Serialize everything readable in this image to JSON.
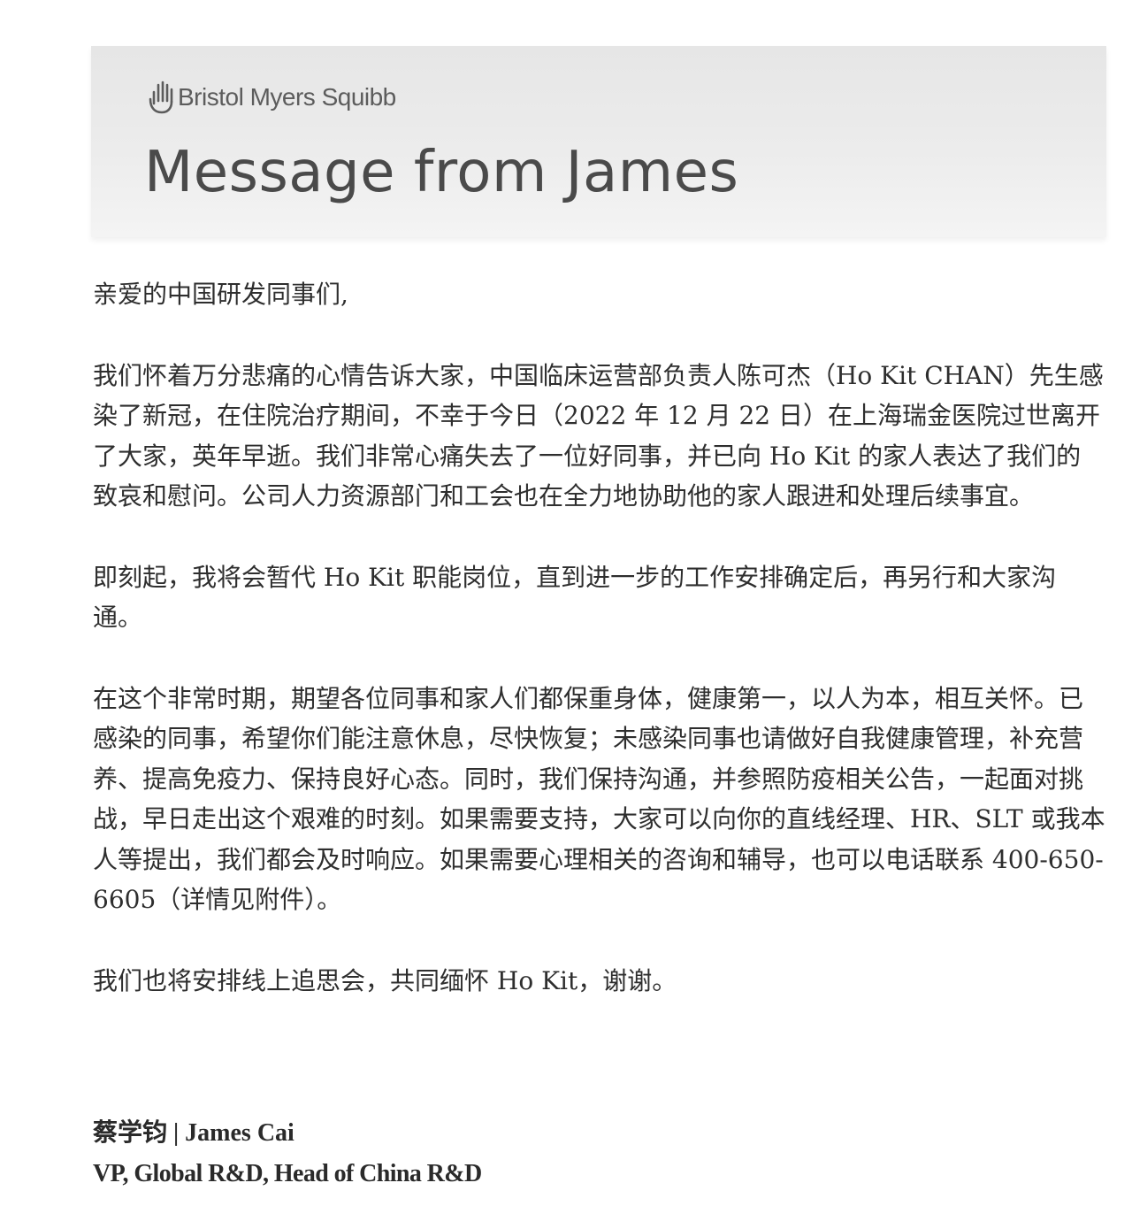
{
  "header": {
    "logo_text": "Bristol Myers Squibb",
    "logo_icon": "hand-icon",
    "title": "Message from James"
  },
  "letter": {
    "salutation": "亲爱的中国研发同事们,",
    "paragraphs": [
      "我们怀着万分悲痛的心情告诉大家，中国临床运营部负责人陈可杰（Ho Kit CHAN）先生感染了新冠，在住院治疗期间，不幸于今日（2022 年 12 月 22 日）在上海瑞金医院过世离开了大家，英年早逝。我们非常心痛失去了一位好同事，并已向 Ho Kit 的家人表达了我们的致哀和慰问。公司人力资源部门和工会也在全力地协助他的家人跟进和处理后续事宜。",
      "即刻起，我将会暂代 Ho Kit 职能岗位，直到进一步的工作安排确定后，再另行和大家沟通。",
      "在这个非常时期，期望各位同事和家人们都保重身体，健康第一，以人为本，相互关怀。已感染的同事，希望你们能注意休息，尽快恢复；未感染同事也请做好自我健康管理，补充营养、提高免疫力、保持良好心态。同时，我们保持沟通，并参照防疫相关公告，一起面对挑战，早日走出这个艰难的时刻。如果需要支持，大家可以向你的直线经理、HR、SLT 或我本人等提出，我们都会及时响应。如果需要心理相关的咨询和辅导，也可以电话联系 400-650-6605（详情见附件）。",
      "我们也将安排线上追思会，共同缅怀 Ho Kit，谢谢。"
    ]
  },
  "signature": {
    "name": "蔡学钧 | James Cai",
    "title": "VP, Global R&D, Head of China R&D"
  }
}
